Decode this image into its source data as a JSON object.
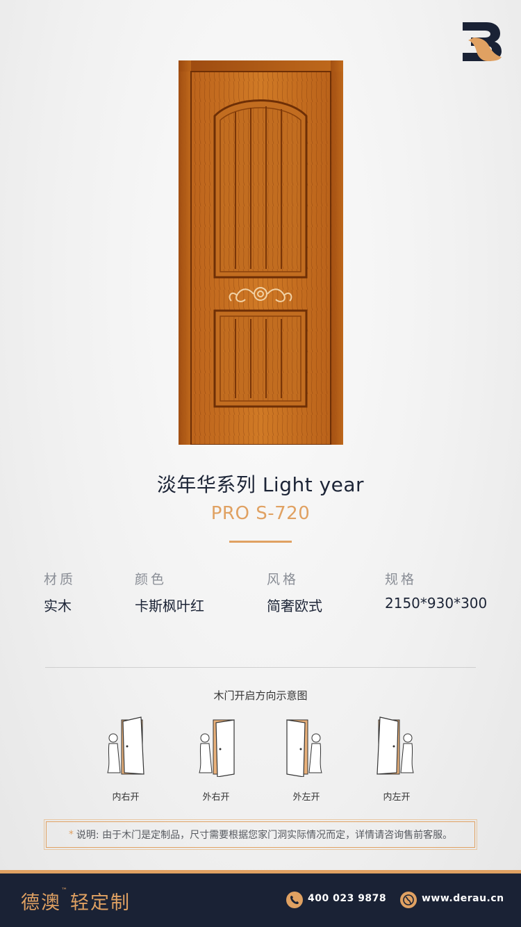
{
  "product": {
    "series_title": "淡年华系列  Light year",
    "model_code": "PRO S-720"
  },
  "specs": [
    {
      "label": "材质",
      "value": "实木"
    },
    {
      "label": "颜色",
      "value": "卡斯枫叶红"
    },
    {
      "label": "风格",
      "value": "简奢欧式"
    },
    {
      "label": "规格",
      "value": "2150*930*300"
    }
  ],
  "opening_diagram": {
    "title": "木门开启方向示意图",
    "options": [
      {
        "label": "内右开"
      },
      {
        "label": "外右开"
      },
      {
        "label": "外左开"
      },
      {
        "label": "内左开"
      }
    ]
  },
  "note": {
    "marker": "*",
    "text": "说明: 由于木门是定制品，尺寸需要根据您家门洞实际情况而定，详情请咨询售前客服。"
  },
  "footer": {
    "brand_name": "德澳",
    "trademark": "™",
    "brand_sub": "轻定制",
    "phone": "400 023 9878",
    "website": "www.derau.cn"
  },
  "icons": {
    "brand_logo": "brand-logo-icon",
    "phone": "phone-icon",
    "website": "globe-icon"
  },
  "colors": {
    "accent": "#e0a162",
    "navy": "#1a2235",
    "door_wood": "#c8701f"
  }
}
